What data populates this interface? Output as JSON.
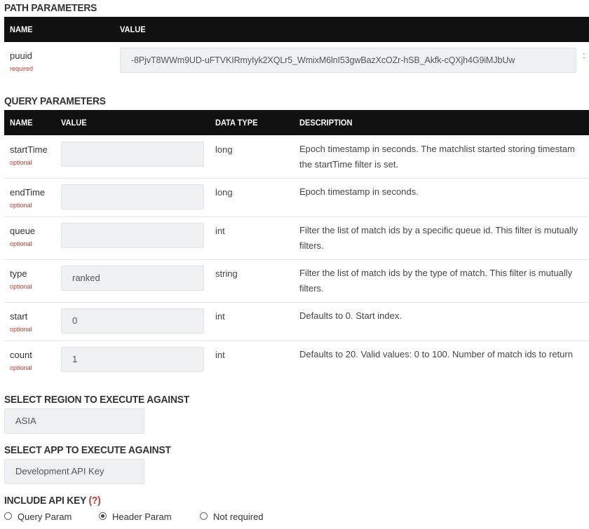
{
  "path_params": {
    "title": "PATH PARAMETERS",
    "headers": {
      "name": "NAME",
      "value": "VALUE"
    },
    "row": {
      "name": "puuid",
      "requirement": "required",
      "value": "-8PjvT8WWm9UD-uFTVKIRmyIyk2XQLr5_WmixM6lnI53gwBazXcOZr-hSB_Akfk-cQXjh4G9iMJbUw"
    }
  },
  "query_params": {
    "title": "QUERY PARAMETERS",
    "headers": {
      "name": "NAME",
      "value": "VALUE",
      "data_type": "DATA TYPE",
      "description": "DESCRIPTION"
    },
    "rows": [
      {
        "name": "startTime",
        "requirement": "optional",
        "value": "",
        "type": "long",
        "desc1": "Epoch timestamp in seconds. The matchlist started storing timestam",
        "desc2": "the startTime filter is set."
      },
      {
        "name": "endTime",
        "requirement": "optional",
        "value": "",
        "type": "long",
        "desc1": "Epoch timestamp in seconds.",
        "desc2": ""
      },
      {
        "name": "queue",
        "requirement": "optional",
        "value": "",
        "type": "int",
        "desc1": "Filter the list of match ids by a specific queue id. This filter is mutually",
        "desc2": "filters."
      },
      {
        "name": "type",
        "requirement": "optional",
        "value": "ranked",
        "type": "string",
        "desc1": "Filter the list of match ids by the type of match. This filter is mutually",
        "desc2": "filters."
      },
      {
        "name": "start",
        "requirement": "optional",
        "value": "0",
        "type": "int",
        "desc1": "Defaults to 0. Start index.",
        "desc2": ""
      },
      {
        "name": "count",
        "requirement": "optional",
        "value": "1",
        "type": "int",
        "desc1": "Defaults to 20. Valid values: 0 to 100. Number of match ids to return",
        "desc2": ""
      }
    ]
  },
  "region": {
    "title": "SELECT REGION TO EXECUTE AGAINST",
    "value": "ASIA"
  },
  "app": {
    "title": "SELECT APP TO EXECUTE AGAINST",
    "value": "Development API Key"
  },
  "api_key": {
    "title": "INCLUDE API KEY",
    "help": "(?)",
    "options": [
      {
        "label": "Query Param",
        "checked": false
      },
      {
        "label": "Header Param",
        "checked": true
      },
      {
        "label": "Not required",
        "checked": false
      }
    ]
  },
  "colors": {
    "header_bg": "#111111",
    "required_red": "#c0392b",
    "input_bg": "#eef0f2"
  }
}
